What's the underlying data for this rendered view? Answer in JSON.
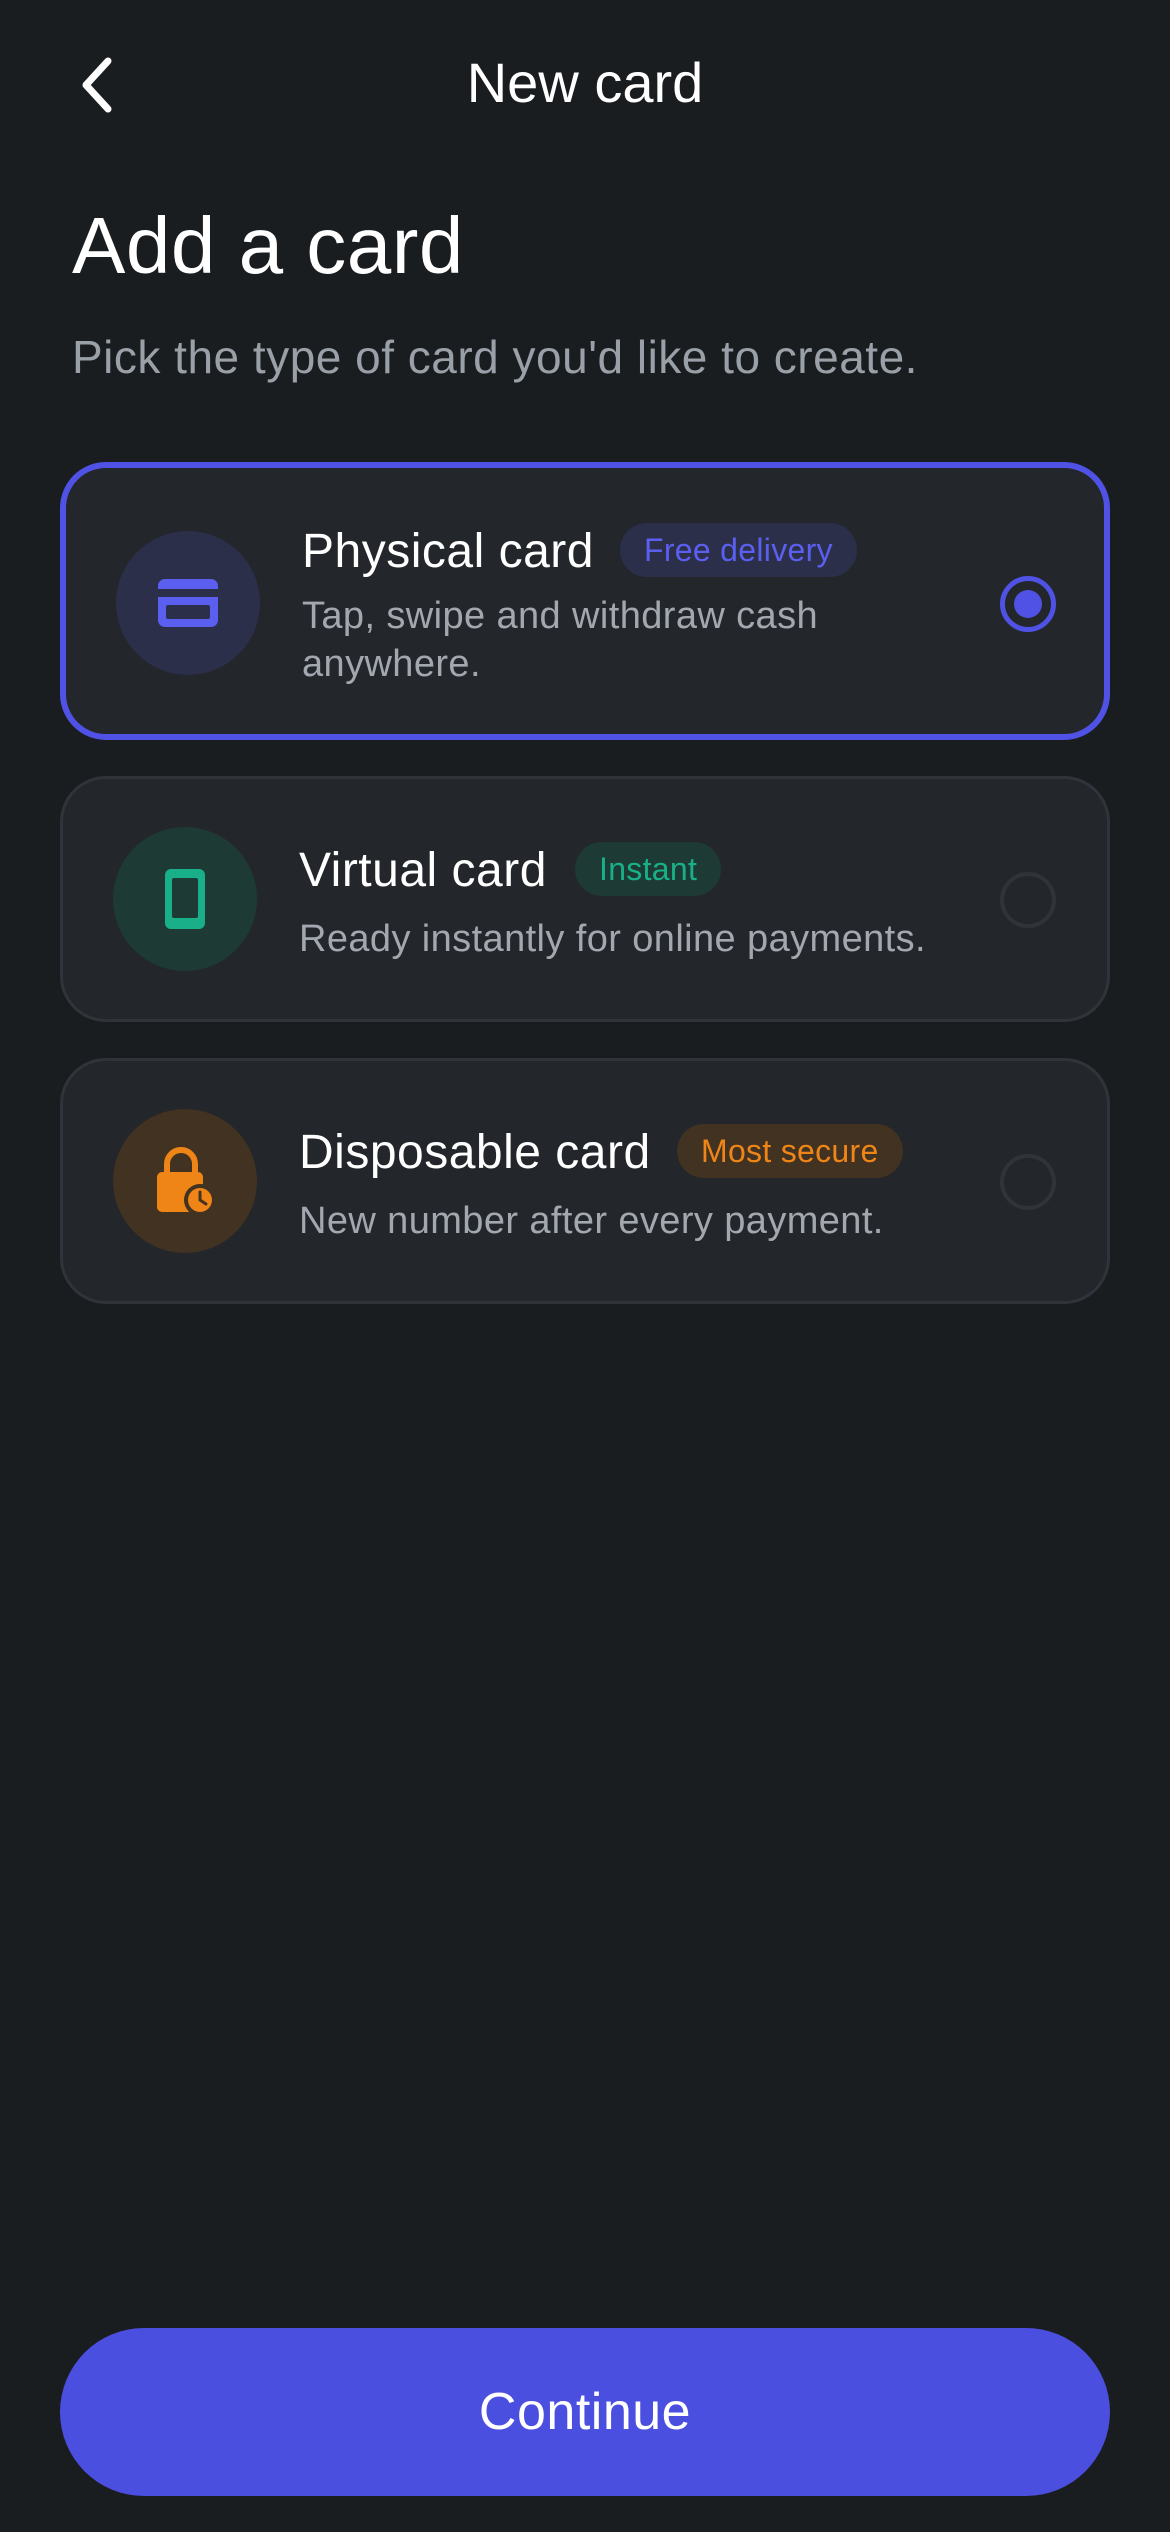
{
  "header": {
    "back_icon": "chevron-left-icon",
    "title": "New card"
  },
  "page": {
    "title": "Add a card",
    "subtitle": "Pick the type of card you'd like to create."
  },
  "options": [
    {
      "title": "Physical card",
      "badge": "Free delivery",
      "description": "Tap, swipe and withdraw cash anywhere.",
      "icon": "credit-card-icon",
      "selected": true,
      "accent": "#5b5ff0"
    },
    {
      "title": "Virtual card",
      "badge": "Instant",
      "description": "Ready instantly for online payments.",
      "icon": "smartphone-icon",
      "selected": false,
      "accent": "#19b089"
    },
    {
      "title": "Disposable card",
      "badge": "Most secure",
      "description": "New number after every payment.",
      "icon": "lock-clock-icon",
      "selected": false,
      "accent": "#ef8517"
    }
  ],
  "footer": {
    "continue_label": "Continue",
    "accent": "#4a4fe0"
  },
  "colors": {
    "background": "#1a1d20",
    "card_background": "#23262a",
    "selected_border": "#4f52e4"
  }
}
